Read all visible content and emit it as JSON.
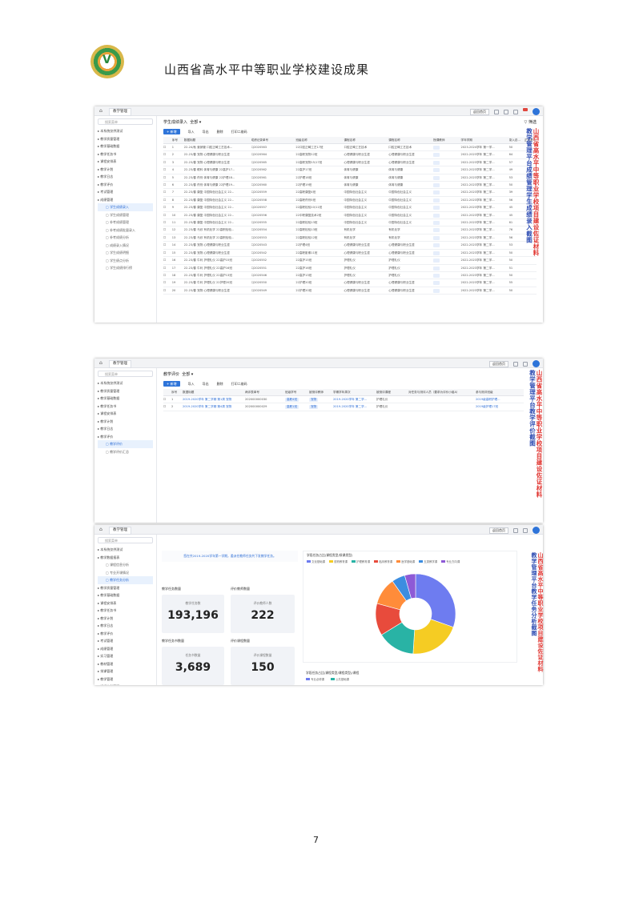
{
  "header": {
    "title": "山西省高水平中等职业学校建设成果"
  },
  "page_number": "7",
  "common": {
    "home": "⌂",
    "tab_teach": "教学管理",
    "search_placeholder": "搜索菜单",
    "top_btn": "返回首页",
    "new_btn": "+ 新增",
    "import": "导入",
    "export": "导出",
    "delete": "删除",
    "print": "打印二维码",
    "all": "全部"
  },
  "shot1": {
    "page_title": "学生成绩录入",
    "stamp": [
      "山西省高水平中等职业学校项目建设佐证材料",
      "教学管理平台成绩管理学生成绩录入截图"
    ],
    "filter": "筛选",
    "sidebar": [
      {
        "label": "本系统仅供测试",
        "cls": ""
      },
      {
        "label": "教学质量管理",
        "cls": ""
      },
      {
        "label": "教学基础数据",
        "cls": ""
      },
      {
        "label": "教学任务书",
        "cls": ""
      },
      {
        "label": "课程安排表",
        "cls": ""
      },
      {
        "label": "教学计划",
        "cls": ""
      },
      {
        "label": "教学日志",
        "cls": ""
      },
      {
        "label": "教学评价",
        "cls": ""
      },
      {
        "label": "考试管理",
        "cls": ""
      },
      {
        "label": "成绩管理",
        "cls": ""
      },
      {
        "label": "学生成绩录入",
        "cls": "sub active"
      },
      {
        "label": "学生成绩管理",
        "cls": "sub"
      },
      {
        "label": "补考成绩管理",
        "cls": "sub"
      },
      {
        "label": "补考成绩批量录入",
        "cls": "sub"
      },
      {
        "label": "补考成绩分析",
        "cls": "sub"
      },
      {
        "label": "成绩录入情况",
        "cls": "sub"
      },
      {
        "label": "学生成绩明细",
        "cls": "sub"
      },
      {
        "label": "学生绩点分析",
        "cls": "sub"
      },
      {
        "label": "学生成绩排行榜",
        "cls": "sub"
      }
    ],
    "columns": [
      "",
      "序号",
      "数据标题",
      "成绩记录单号",
      "班级名称",
      "课程名称",
      "课程名称",
      "授课教师",
      "学年学期",
      "录入总...",
      "正常考..."
    ],
    "rows": [
      [
        "1",
        "22-24/秋 营销管 口腔正畸工艺技术...",
        "CJ2020563",
        "22口腔正畸工艺17班",
        "口腔正畸工艺技术",
        "口腔正畸工艺技术",
        "",
        "2023-2024学年 第一学...",
        "50"
      ],
      [
        "2",
        "22-23/春 宠物 心理健康与职业生涯",
        "CJ2020564",
        "22高职宠物12班",
        "心理健康与职业生涯",
        "心理健康与职业生涯",
        "",
        "2022-2023学年 第二学...",
        "64"
      ],
      [
        "3",
        "22-23/春 宠物 心理健康与职业生涯",
        "CJ2020565",
        "22高职宠物15/17班",
        "心理健康与职业生涯",
        "心理健康与职业生涯",
        "",
        "2022-2023学年 第二学...",
        "57"
      ],
      [
        "4",
        "22-23/春 眼科 体育与健康 22高护17...",
        "CJ2020562",
        "22高护17班",
        "体育与健康",
        "体育与健康",
        "",
        "2022-2023学年 第二学...",
        "49"
      ],
      [
        "5",
        "22-23/春 药剂 体育与健康 22护理18...",
        "CJ2020561",
        "22护理18班",
        "体育与健康",
        "体育与健康",
        "",
        "2022-2023学年 第二学...",
        "53"
      ],
      [
        "6",
        "22-23/春 药剂 体育与健康 22护理19...",
        "CJ2020560",
        "22护理19班",
        "体育与健康",
        "体育与健康",
        "",
        "2022-2023学年 第二学...",
        "50"
      ],
      [
        "7",
        "22-23/春 康复 中国特色社会主义 22...",
        "CJ2020559",
        "22高职康复4班",
        "中国特色社会主义",
        "中国特色社会主义",
        "",
        "2022-2023学年 第二学...",
        "39"
      ],
      [
        "8",
        "22-23/春 康复 中国特色社会主义 22...",
        "CJ2020558",
        "22高职药剂5班",
        "中国特色社会主义",
        "中国特色社会主义",
        "",
        "2022-2023学年 第二学...",
        "56"
      ],
      [
        "9",
        "22-23/春 康复 中国特色社会主义 22...",
        "CJ2020557",
        "22高职检验10/11班",
        "中国特色社会主义",
        "中国特色社会主义",
        "",
        "2022-2023学年 第二学...",
        "45"
      ],
      [
        "10",
        "22-23/春 康复 中国特色社会主义 22...",
        "CJ2020556",
        "22中职康复技术2班",
        "中国特色社会主义",
        "中国特色社会主义",
        "",
        "2022-2023学年 第二学...",
        "45"
      ],
      [
        "11",
        "22-23/春 康复 中国特色社会主义 22...",
        "CJ2020555",
        "22高职检验13班",
        "中国特色社会主义",
        "中国特色社会主义",
        "",
        "2022-2023学年 第二学...",
        "61"
      ],
      [
        "12",
        "22-23/春 马欣 有机化学 22高职检验...",
        "CJ2020554",
        "22高职检验13班",
        "有机化学",
        "有机化学",
        "",
        "2022-2023学年 第二学...",
        "76"
      ],
      [
        "13",
        "22-23/春 马欣 有机化学 22高职检验...",
        "CJ2020553",
        "22高职检验12班",
        "有机化学",
        "有机化学",
        "",
        "2022-2023学年 第二学...",
        "56"
      ],
      [
        "14",
        "22-23/春 宠物 心理健康与职业生涯",
        "CJ2020543",
        "22护理4班",
        "心理健康与职业生涯",
        "心理健康与职业生涯",
        "",
        "2022-2023学年 第二学...",
        "53"
      ],
      [
        "15",
        "22-23/春 宠物 心理健康与职业生涯",
        "CJ2020542",
        "22高职影像11班",
        "心理健康与职业生涯",
        "心理健康与职业生涯",
        "",
        "2022-2023学年 第二学...",
        "50"
      ],
      [
        "16",
        "22-23/春 牛利 护理礼仪 22高护15班",
        "CJ2020552",
        "22高护15班",
        "护理礼仪",
        "护理礼仪",
        "",
        "2022-2023学年 第二学...",
        "50"
      ],
      [
        "17",
        "22-23/春 牛利 护理礼仪 22高护16班",
        "CJ2020551",
        "22高护16班",
        "护理礼仪",
        "护理礼仪",
        "",
        "2022-2023学年 第二学...",
        "51"
      ],
      [
        "18",
        "22-23/春 牛利 护理礼仪 22高护13班",
        "CJ2020546",
        "22高护13班",
        "护理礼仪",
        "护理礼仪",
        "",
        "2022-2023学年 第二学...",
        "50"
      ],
      [
        "19",
        "22-23/春 牛利 护理礼仪 22护理20班",
        "CJ2020550",
        "22护理20班",
        "心理健康与职业生涯",
        "心理健康与职业生涯",
        "",
        "2022-2023学年 第二学...",
        "55"
      ],
      [
        "20",
        "22-23/春 宠物 心理健康与职业生涯",
        "CJ2020549",
        "22护理20班",
        "心理健康与职业生涯",
        "心理健康与职业生涯",
        "",
        "2022-2023学年 第二学...",
        "50"
      ]
    ]
  },
  "shot2": {
    "page_title": "教学评价",
    "stamp": [
      "山西省高水平中等职业学校项目建设佐证材料",
      "教学管理平台教学评价截图"
    ],
    "sidebar": [
      {
        "label": "本系统仅供测试",
        "cls": ""
      },
      {
        "label": "教学质量管理",
        "cls": ""
      },
      {
        "label": "教学基础数据",
        "cls": ""
      },
      {
        "label": "教学任务书",
        "cls": ""
      },
      {
        "label": "课程安排表",
        "cls": ""
      },
      {
        "label": "教学计划",
        "cls": ""
      },
      {
        "label": "教学日志",
        "cls": ""
      },
      {
        "label": "教学评价",
        "cls": ""
      },
      {
        "label": "教学评价",
        "cls": "sub active"
      },
      {
        "label": "教学评价汇总",
        "cls": "sub"
      }
    ],
    "columns": [
      "",
      "序号",
      "数据标题",
      "两评表单号",
      "班级学号",
      "被测评教师",
      "学期学年周次",
      "被测评课程",
      "对任务与测评人员（要求为评价小组A）",
      "参与测评班级"
    ],
    "rows": [
      [
        "1",
        "2019-2020学年 第二学期 第1周 宠物",
        "202000000030",
        "高职4班",
        "宠物",
        "2019-2020学年 第二学...",
        "护理礼仪",
        "",
        "2019级高职护理..."
      ],
      [
        "2",
        "2019-2020学年 第二学期 第4周 宠物",
        "202000000029",
        "高职1班",
        "宠物",
        "2019-2020学年 第二学...",
        "护理礼仪",
        "",
        "2019级护理17班"
      ]
    ]
  },
  "shot3": {
    "stamp": [
      "山西省高水平中等职业学校项目建设佐证材料",
      "教学管理平台教学任务分析截图"
    ],
    "banner": "您在共2019-2020学年第一学期，委派任教师任务共下发教学任务。",
    "pie_title": "学段任务占比(课程类型/授课类型)",
    "bar_title": "学段任务占比(课程类型/课程类型)/课程",
    "bar_legend": [
      "专业必修课",
      "公共基础课"
    ],
    "sidebar": [
      {
        "label": "本系统仅供测试",
        "cls": ""
      },
      {
        "label": "教学数据报表",
        "cls": ""
      },
      {
        "label": "课程信息分析",
        "cls": "sub"
      },
      {
        "label": "专业开课情况",
        "cls": "sub"
      },
      {
        "label": "教学任务分析",
        "cls": "sub active"
      },
      {
        "label": "教学质量管理",
        "cls": ""
      },
      {
        "label": "教学基础数据",
        "cls": ""
      },
      {
        "label": "课程安排表",
        "cls": ""
      },
      {
        "label": "教学任务书",
        "cls": ""
      },
      {
        "label": "教学计划",
        "cls": ""
      },
      {
        "label": "教学日志",
        "cls": ""
      },
      {
        "label": "教学评价",
        "cls": ""
      },
      {
        "label": "考试管理",
        "cls": ""
      },
      {
        "label": "成绩管理",
        "cls": ""
      },
      {
        "label": "实习管理",
        "cls": ""
      },
      {
        "label": "教材管理",
        "cls": ""
      },
      {
        "label": "排课管理",
        "cls": ""
      },
      {
        "label": "教学管理",
        "cls": ""
      },
      {
        "label": "课程计划管理",
        "cls": ""
      },
      {
        "label": "线上教学课程",
        "cls": ""
      }
    ],
    "stats": [
      {
        "label": "教学任务数量",
        "sub": "教学任务数",
        "value": "193,196"
      },
      {
        "label": "评价教师数量",
        "sub": "评价教师人数",
        "value": "222"
      },
      {
        "label": "教学任务书数量",
        "sub": "任务书数量",
        "value": "3,689"
      },
      {
        "label": "评价课程数量",
        "sub": "评价课程数量",
        "value": "150"
      }
    ],
    "pie_legend": [
      "文化基础课",
      "德育教育课",
      "护理教育课",
      "临床教育课",
      "医学基础课",
      "五类教学课",
      "专业方向课"
    ]
  },
  "chart_data": {
    "type": "pie",
    "title": "",
    "donut": true,
    "series": [
      {
        "label": "文化基础课",
        "value": 30.4,
        "color": "#6e7cf0"
      },
      {
        "label": "德育教育课",
        "value": 20.6,
        "color": "#f5cc23"
      },
      {
        "label": "护理教育课",
        "value": 15.2,
        "color": "#29b3a5"
      },
      {
        "label": "临床教育课",
        "value": 13.0,
        "color": "#e84b3c"
      },
      {
        "label": "医学基础课",
        "value": 11.0,
        "color": "#ff8c3a"
      },
      {
        "label": "五类教学课",
        "value": 5.4,
        "color": "#3c8de0"
      },
      {
        "label": "专业方向课",
        "value": 4.4,
        "color": "#8e5ad6"
      }
    ]
  }
}
